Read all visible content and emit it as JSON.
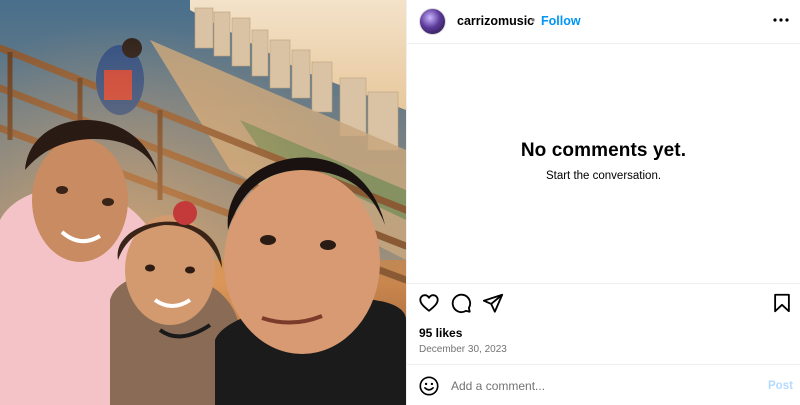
{
  "post": {
    "photo_alt": "",
    "icons": {
      "photo": "selfie-photo"
    }
  },
  "header": {
    "username": "carrizomusic",
    "separator": "•",
    "follow_label": "Follow",
    "more_icon": "more-horizontal-icon"
  },
  "comments": {
    "empty_title": "No comments yet.",
    "empty_subtitle": "Start the conversation."
  },
  "actions": {
    "icons": [
      "heart-icon",
      "comment-icon",
      "share-icon",
      "bookmark-icon"
    ]
  },
  "stats": {
    "likes": "95 likes",
    "date": "December 30, 2023"
  },
  "composer": {
    "placeholder": "Add a comment...",
    "post_label": "Post",
    "emoji_icon": "emoji-icon"
  },
  "colors": {
    "accent": "#0095f6",
    "post_disabled": "#b3dbff",
    "muted_text": "#737373",
    "divider": "#efefef"
  }
}
